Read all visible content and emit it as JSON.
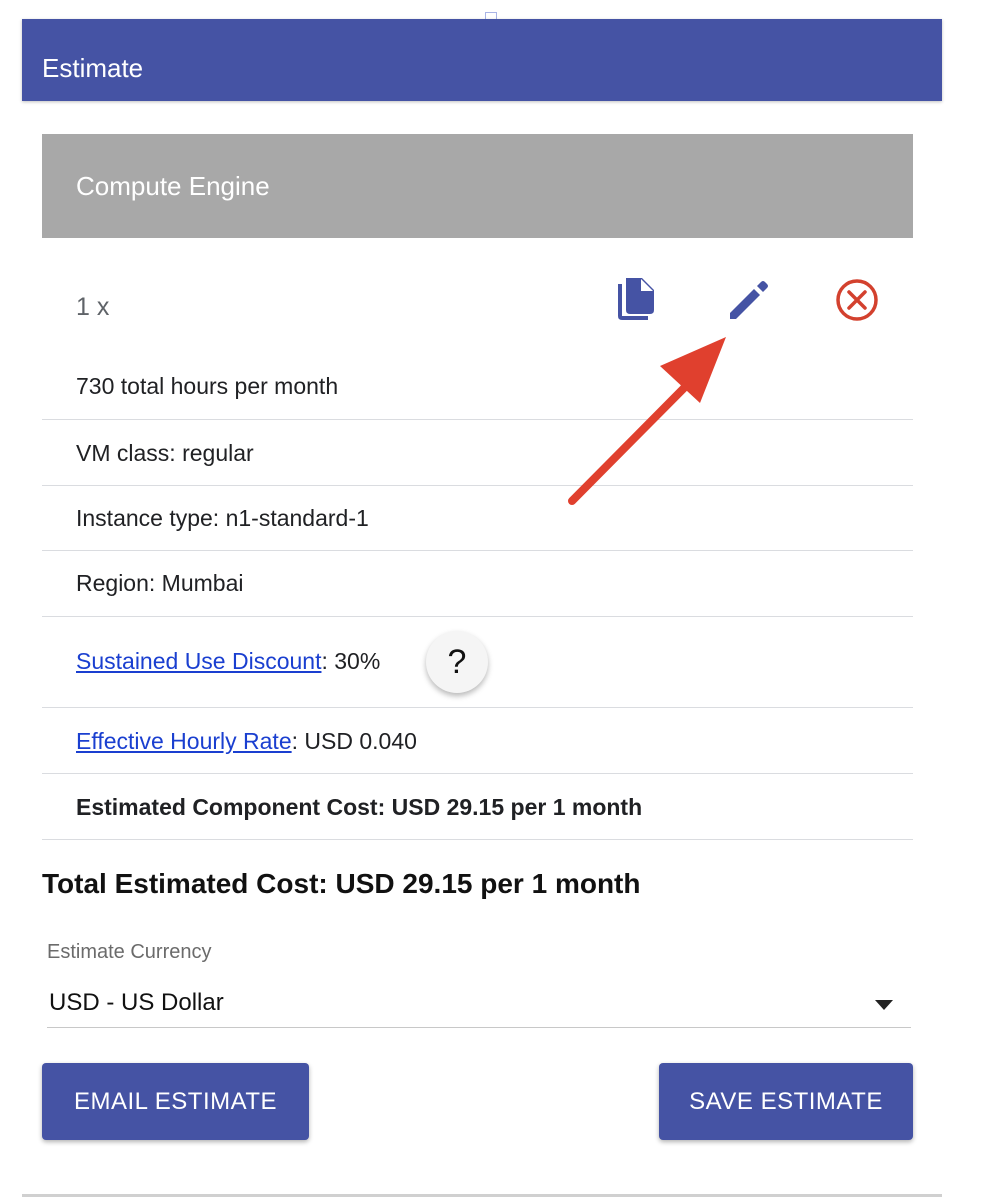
{
  "header": {
    "title": "Estimate"
  },
  "section": {
    "title": "Compute Engine"
  },
  "item": {
    "quantity": "1 x",
    "actions": {
      "copy_icon": "copy-icon",
      "edit_icon": "pencil-icon",
      "remove_icon": "close-circle-icon"
    },
    "details": {
      "hours": "730 total hours per month",
      "vm_class": "VM class: regular",
      "instance_type": "Instance type: n1-standard-1",
      "region": "Region: Mumbai",
      "sustained_use_link": "Sustained Use Discount",
      "sustained_use_value": ": 30%",
      "help_label": "?",
      "hourly_rate_link": "Effective Hourly Rate",
      "hourly_rate_value": ": USD 0.040",
      "component_cost": "Estimated Component Cost: USD 29.15 per 1 month"
    }
  },
  "total": "Total Estimated Cost: USD 29.15 per 1 month",
  "currency": {
    "label": "Estimate Currency",
    "selected": "USD - US Dollar"
  },
  "buttons": {
    "email": "EMAIL ESTIMATE",
    "save": "SAVE ESTIMATE"
  },
  "colors": {
    "primary": "#4553a4",
    "section_header": "#a8a8a8",
    "remove": "#d3412e",
    "annotation_arrow": "#e0402e",
    "link": "#1a3fd0"
  }
}
